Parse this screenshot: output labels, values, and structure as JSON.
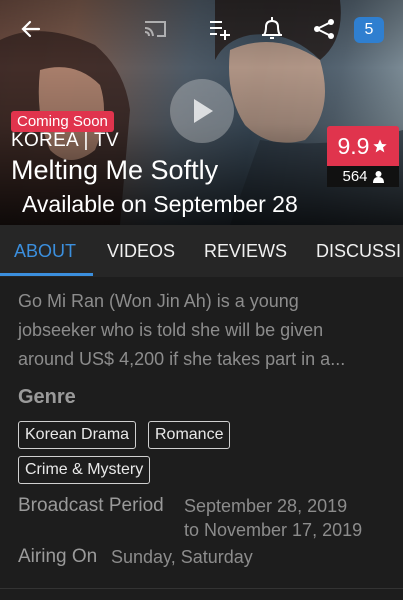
{
  "header": {
    "notification_count": "5",
    "icons": [
      "back-arrow-icon",
      "cast-icon",
      "add-to-list-icon",
      "bell-plus-icon",
      "share-icon"
    ]
  },
  "show": {
    "status_badge": "Coming Soon",
    "country_type": "KOREA | TV",
    "title": "Melting Me Softly",
    "availability": "Available on September 28",
    "rating": "9.9",
    "votes": "564"
  },
  "tabs": [
    {
      "label": "ABOUT",
      "active": true
    },
    {
      "label": "VIDEOS",
      "active": false
    },
    {
      "label": "REVIEWS",
      "active": false
    },
    {
      "label": "DISCUSSI",
      "active": false
    }
  ],
  "about": {
    "synopsis_lines": [
      "Go Mi Ran (Won Jin Ah) is a young",
      "jobseeker who is told she will be given",
      "around US$ 4,200 if she takes part in a..."
    ],
    "genre_heading": "Genre",
    "genres": [
      "Korean Drama",
      "Romance",
      "Crime & Mystery"
    ],
    "broadcast_label": "Broadcast Period",
    "broadcast_lines": [
      "September 28, 2019",
      "to November 17, 2019"
    ],
    "airing_label": "Airing On",
    "airing_value": "Sunday, Saturday"
  },
  "colors": {
    "accent_red": "#e0344d",
    "accent_blue": "#3b8fde",
    "background": "#1d1d1d"
  }
}
